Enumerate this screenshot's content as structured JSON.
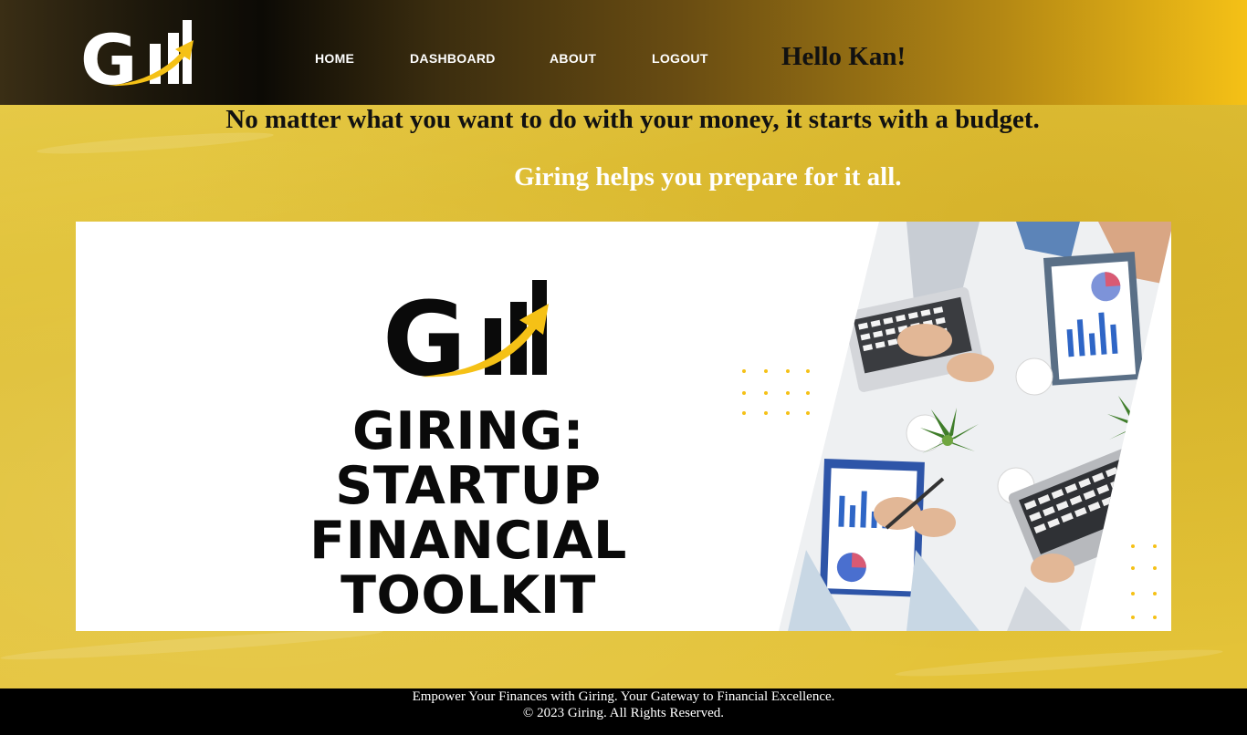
{
  "brand": {
    "logo_text": "Gill",
    "accent_color": "#f5c116"
  },
  "header": {
    "nav": [
      {
        "label": "HOME"
      },
      {
        "label": "DASHBOARD"
      },
      {
        "label": "ABOUT"
      },
      {
        "label": "LOGOUT"
      }
    ],
    "greeting": "Hello Kan!"
  },
  "main": {
    "tagline": "No matter what you want to do with your money, it starts with a budget.",
    "subtagline": "Giring helps you prepare for it all.",
    "banner": {
      "logo_text": "Gill",
      "title_lines": [
        "GIRING: STARTUP",
        "FINANCIAL",
        "TOOLKIT"
      ],
      "photo": "team-meeting-laptops-charts-photo"
    }
  },
  "footer": {
    "line1": "Empower Your Finances with Giring. Your Gateway to Financial Excellence.",
    "line2": "© 2023 Giring. All Rights Reserved."
  }
}
